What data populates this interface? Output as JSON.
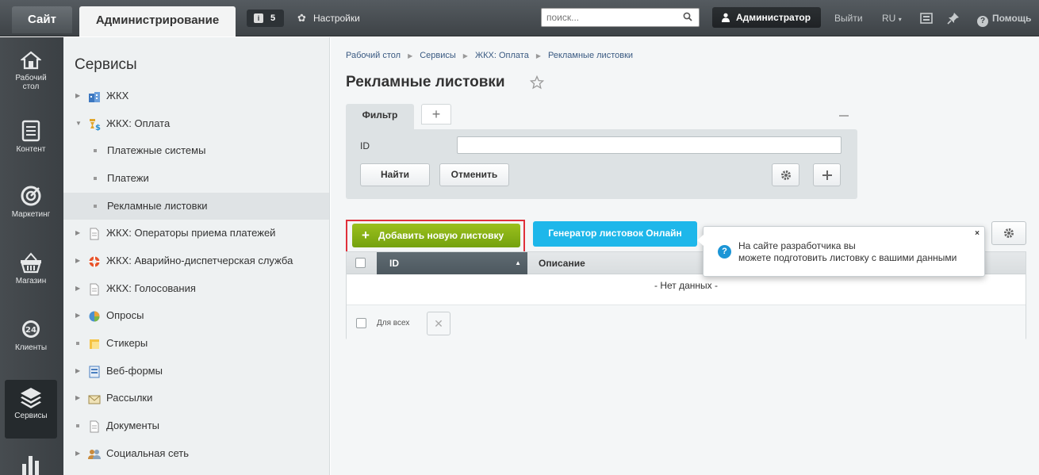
{
  "topbar": {
    "site_tab": "Сайт",
    "admin_tab": "Администрирование",
    "notifications_count": "5",
    "settings_label": "Настройки",
    "search_placeholder": "поиск...",
    "user_label": "Администратор",
    "logout_label": "Выйти",
    "lang_label": "RU",
    "help_label": "Помощь"
  },
  "rail": [
    {
      "label_1": "Рабочий",
      "label_2": "стол",
      "icon": "home-icon"
    },
    {
      "label_1": "Контент",
      "label_2": "",
      "icon": "document-icon"
    },
    {
      "label_1": "Маркетинг",
      "label_2": "",
      "icon": "target-icon"
    },
    {
      "label_1": "Магазин",
      "label_2": "",
      "icon": "basket-icon"
    },
    {
      "label_1": "Клиенты",
      "label_2": "",
      "icon": "clock-24-icon"
    },
    {
      "label_1": "Сервисы",
      "label_2": "",
      "icon": "layers-icon"
    }
  ],
  "subnav": {
    "title": "Сервисы",
    "items": [
      {
        "label": "ЖКХ"
      },
      {
        "label": "ЖКХ: Оплата"
      },
      {
        "label": "Платежные системы"
      },
      {
        "label": "Платежи"
      },
      {
        "label": "Рекламные листовки"
      },
      {
        "label": "ЖКХ: Операторы приема платежей"
      },
      {
        "label": "ЖКХ: Аварийно-диспетчерская служба"
      },
      {
        "label": "ЖКХ: Голосования"
      },
      {
        "label": "Опросы"
      },
      {
        "label": "Стикеры"
      },
      {
        "label": "Веб-формы"
      },
      {
        "label": "Рассылки"
      },
      {
        "label": "Документы"
      },
      {
        "label": "Социальная сеть"
      }
    ]
  },
  "breadcrumb": [
    "Рабочий стол",
    "Сервисы",
    "ЖКХ: Оплата",
    "Рекламные листовки"
  ],
  "page_title": "Рекламные листовки",
  "filter": {
    "tab_label": "Фильтр",
    "add_tab": "+",
    "id_label": "ID",
    "id_value": "",
    "find_button": "Найти",
    "cancel_button": "Отменить"
  },
  "actions": {
    "add_button": "Добавить новую листовку",
    "generator_button": "Генератор листовок Онлайн"
  },
  "tooltip": {
    "line1": "На сайте разработчика вы",
    "line2": "можете подготовить листовку с вашими данными",
    "close": "×"
  },
  "grid": {
    "col_id": "ID",
    "col_desc": "Описание",
    "empty_text": "- Нет данных -",
    "for_all_label": "Для всех"
  },
  "colors": {
    "add_green": "#7fab12",
    "generator_blue": "#1eb7ea",
    "highlight_red": "#e0303a"
  }
}
